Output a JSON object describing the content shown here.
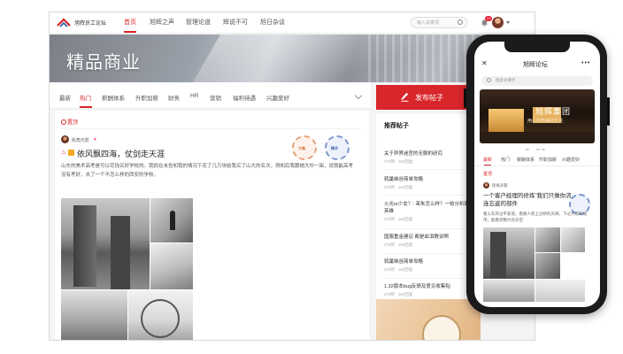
{
  "header": {
    "logo_text": "旭辉员工论坛",
    "nav": [
      "首页",
      "旭辉之声",
      "管理论道",
      "辉说不可",
      "旭日杂谈"
    ],
    "search_placeholder": "输入关键词",
    "notification_count": "12",
    "brand_color": "#d8262a"
  },
  "banner": {
    "title": "精品商业"
  },
  "tabs": [
    "最新",
    "热门",
    "薪酬体系",
    "升职加薪",
    "财务",
    "HR",
    "营销",
    "福利待遇",
    "兴趣爱好"
  ],
  "post_button": "发布帖子",
  "post": {
    "pinned_label": "置顶",
    "author": "街角光影",
    "title": "依风飘四海，仗剑走天涯",
    "body": "山东的美术高考是可以花钱买好学校的。我妈在未告知我的情况下花了几万块给我买了山大的名次，得知后我跟她大吵一架，说我能高考没有考好，去了一个不怎么样的西安的学校。",
    "stamp1": "大咖",
    "stamp2": "精华"
  },
  "sidebar": {
    "title": "推荐帖子",
    "items": [
      {
        "title": "关于异界迷宫的无聊的研究",
        "meta": "276赞 · 164回复"
      },
      {
        "title": "鸦巢峡谷简单攻略",
        "meta": "276赞 · 164回复"
      },
      {
        "title": "火光or少女？: 茉朱怎么样？一帖分析新出英雄",
        "meta": "276赞 · 164回复"
      },
      {
        "title": "国服重金建议 都是血泪教训啊",
        "meta": "276赞 · 164回复"
      },
      {
        "title": "鸦巢峡谷简单攻略",
        "meta": "276赞 · 164回复"
      },
      {
        "title": "1.32版本bug反馈及意见收集贴",
        "meta": "276赞 · 164回复"
      }
    ]
  },
  "mobile": {
    "title": "旭辉论坛",
    "search_placeholder": "搜索关键字",
    "banner_title": "旭辉集团",
    "banner_subtitle": "用心构筑美好生活",
    "tabs": [
      "最新",
      "热门",
      "薪酬体系",
      "升职加薪",
      "兴趣爱好"
    ],
    "pinned_label": "置顶",
    "author": "街角光影",
    "post_title": "一个客户经理的修炼”我们只做你流连忘返的部件",
    "post_body": "看火车开过平安道，看路人爬上过桥的天梯，下过大雨的城市，能看到整片的天空"
  }
}
